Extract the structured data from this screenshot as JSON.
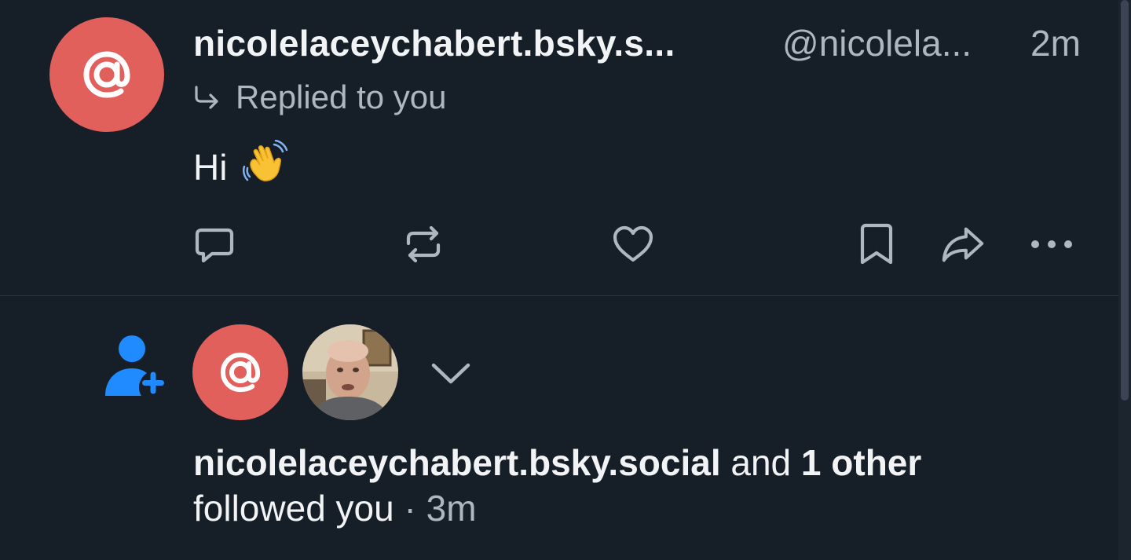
{
  "reply_notification": {
    "author_display_name": "nicolelaceychabert.bsky.s...",
    "author_handle": "@nicolela...",
    "time": "2m",
    "context_label": "Replied to you",
    "post_text": "Hi",
    "post_emoji": "👋",
    "actions": [
      "reply-icon",
      "repost-icon",
      "like-icon",
      "bookmark-icon",
      "share-icon",
      "more-icon"
    ]
  },
  "follow_notification": {
    "name": "nicolelaceychabert.bsky.social",
    "connector": " and ",
    "others": "1 other",
    "action_text": "followed you",
    "separator": " · ",
    "time": "3m"
  },
  "colors": {
    "background": "#161e27",
    "default_avatar": "#e2605c",
    "accent_blue": "#208bfe",
    "muted_text": "#aeb6c2"
  }
}
